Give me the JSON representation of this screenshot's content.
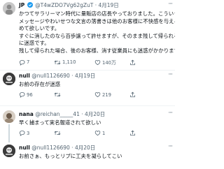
{
  "tweet1": {
    "name": "JP",
    "handle": "@T4wZDO7Vg62gZuT",
    "date": "· 4月19日",
    "lines": [
      "かつてサラリーマン時代に量販店の店長やっておりました。こういう",
      "メッセージやわいせつな文言の落書きは他のお客様に不快感を与える",
      "めて欲しいです。",
      "すぐに消したのなら百歩譲って許せますが、そのまま残して帰られる",
      "に迷惑です。",
      "残して帰られた場合、後のお客様、消す従業員にも迷惑がかかります"
    ],
    "stats": {
      "replies": "7",
      "retweets": "1,110",
      "likes": "140万"
    }
  },
  "tweet2": {
    "name": "null",
    "handle": "@null1126690 · 4月19日",
    "text": "お前の存在が迷惑",
    "stats": {
      "replies": "96",
      "retweets": "",
      "likes": "219"
    }
  },
  "tweet3": {
    "name": "nana",
    "handle": "@reichan_____41 · 4月20日",
    "text": "早く捕まって実名報道されて欲しい",
    "stats": {
      "replies": "3",
      "retweets": "",
      "likes": "1"
    }
  },
  "tweet4": {
    "name": "null",
    "handle": "@null1126690 · 4月20日",
    "text": "お前さぁ、もっとリプに工夫を凝らしてこい"
  },
  "colors": {
    "verified": "#1d9bf0",
    "muted": "#536471",
    "line": "#cfd9de"
  }
}
